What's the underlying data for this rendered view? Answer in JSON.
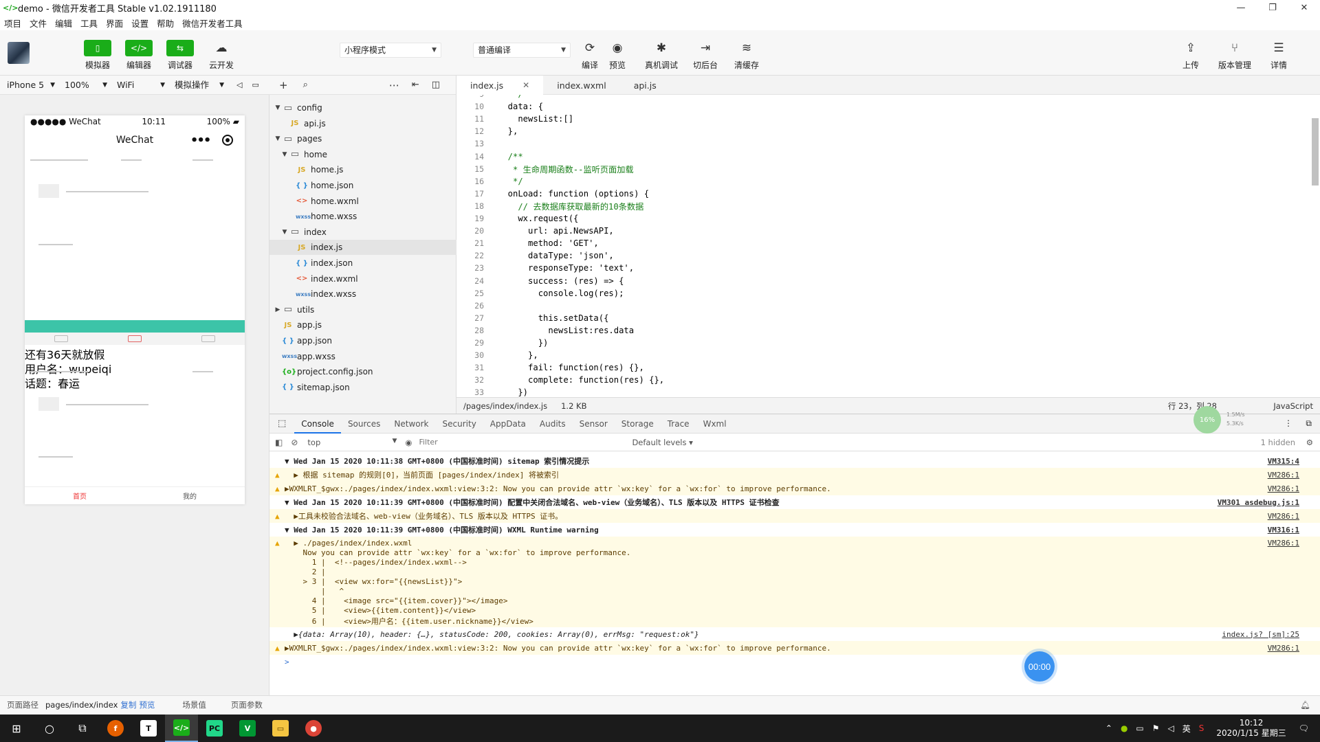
{
  "window": {
    "title": "demo - 微信开发者工具 Stable v1.02.1911180",
    "controls": [
      "—",
      "❐",
      "✕"
    ]
  },
  "menu": [
    "项目",
    "文件",
    "编辑",
    "工具",
    "界面",
    "设置",
    "帮助",
    "微信开发者工具"
  ],
  "toolbar": {
    "simulator": "模拟器",
    "editor": "编辑器",
    "debugger": "调试器",
    "cloud": "云开发",
    "mode": "小程序模式",
    "compile_mode": "普通编译",
    "compile": "编译",
    "preview": "预览",
    "real_debug": "真机调试",
    "background": "切后台",
    "clear_cache": "清缓存",
    "upload": "上传",
    "version": "版本管理",
    "details": "详情"
  },
  "devbar": {
    "device": "iPhone 5",
    "zoom": "100%",
    "network": "WiFi",
    "operation": "模拟操作"
  },
  "phone": {
    "carrier": "●●●●● WeChat",
    "time": "10:11",
    "battery": "100%",
    "nav_title": "WeChat",
    "overlay": [
      "还有36天就放假",
      "用户名：wupeiqi",
      "话题：春运"
    ],
    "tab_home": "首页",
    "tab_mine": "我的"
  },
  "footer": {
    "path_label": "页面路径",
    "path": "pages/index/index",
    "copy": "复制",
    "preview": "预览",
    "scene": "场景值",
    "params": "页面参数"
  },
  "explorer": [
    {
      "label": "config",
      "type": "folder",
      "open": true,
      "indent": 0
    },
    {
      "label": "api.js",
      "type": "js",
      "indent": 1
    },
    {
      "label": "pages",
      "type": "folder",
      "open": true,
      "indent": 0
    },
    {
      "label": "home",
      "type": "folder",
      "open": true,
      "indent": 1
    },
    {
      "label": "home.js",
      "type": "js",
      "indent": 2
    },
    {
      "label": "home.json",
      "type": "json",
      "indent": 2
    },
    {
      "label": "home.wxml",
      "type": "wxml",
      "indent": 2
    },
    {
      "label": "home.wxss",
      "type": "wxss",
      "indent": 2
    },
    {
      "label": "index",
      "type": "folder",
      "open": true,
      "indent": 1
    },
    {
      "label": "index.js",
      "type": "js",
      "indent": 2,
      "selected": true
    },
    {
      "label": "index.json",
      "type": "json",
      "indent": 2
    },
    {
      "label": "index.wxml",
      "type": "wxml",
      "indent": 2
    },
    {
      "label": "index.wxss",
      "type": "wxss",
      "indent": 2
    },
    {
      "label": "utils",
      "type": "folder",
      "open": false,
      "indent": 0
    },
    {
      "label": "app.js",
      "type": "js",
      "indent": 0
    },
    {
      "label": "app.json",
      "type": "json",
      "indent": 0
    },
    {
      "label": "app.wxss",
      "type": "wxss",
      "indent": 0
    },
    {
      "label": "project.config.json",
      "type": "cfg",
      "indent": 0
    },
    {
      "label": "sitemap.json",
      "type": "json",
      "indent": 0
    }
  ],
  "tabs": [
    "index.js",
    "index.wxml",
    "api.js"
  ],
  "code": [
    {
      "n": "9",
      "t": "   */"
    },
    {
      "n": "10",
      "t": "  data: {"
    },
    {
      "n": "11",
      "t": "    newsList:[]"
    },
    {
      "n": "12",
      "t": "  },"
    },
    {
      "n": "13",
      "t": ""
    },
    {
      "n": "14",
      "t": "  /**"
    },
    {
      "n": "15",
      "t": "   * 生命周期函数--监听页面加载"
    },
    {
      "n": "16",
      "t": "   */"
    },
    {
      "n": "17",
      "t": "  onLoad: function (options) {"
    },
    {
      "n": "18",
      "t": "    // 去数据库获取最新的10条数据"
    },
    {
      "n": "19",
      "t": "    wx.request({"
    },
    {
      "n": "20",
      "t": "      url: api.NewsAPI,"
    },
    {
      "n": "21",
      "t": "      method: 'GET',"
    },
    {
      "n": "22",
      "t": "      dataType: 'json',"
    },
    {
      "n": "23",
      "t": "      responseType: 'text',"
    },
    {
      "n": "24",
      "t": "      success: (res) => {"
    },
    {
      "n": "25",
      "t": "        console.log(res);"
    },
    {
      "n": "26",
      "t": ""
    },
    {
      "n": "27",
      "t": "        this.setData({"
    },
    {
      "n": "28",
      "t": "          newsList:res.data"
    },
    {
      "n": "29",
      "t": "        })"
    },
    {
      "n": "30",
      "t": "      },"
    },
    {
      "n": "31",
      "t": "      fail: function(res) {},"
    },
    {
      "n": "32",
      "t": "      complete: function(res) {},"
    },
    {
      "n": "33",
      "t": "    })"
    }
  ],
  "status": {
    "path": "/pages/index/index.js",
    "size": "1.2 KB",
    "position": "行 23，列 28",
    "language": "JavaScript"
  },
  "devtools": {
    "tabs": [
      "Console",
      "Sources",
      "Network",
      "Security",
      "AppData",
      "Audits",
      "Sensor",
      "Storage",
      "Trace",
      "Wxml"
    ],
    "context": "top",
    "filter_placeholder": "Filter",
    "levels": "Default levels ▾",
    "hidden": "1 hidden",
    "perf_pct": "16%",
    "perf_up": "1.5M/s",
    "perf_down": "5.3K/s"
  },
  "console": [
    {
      "kind": "group",
      "text": "▼ Wed Jan 15 2020 10:11:38 GMT+0800 (中国标准时间) sitemap 索引情况提示",
      "src": "VM315:4"
    },
    {
      "kind": "warn",
      "text": "  ▶ 根据 sitemap 的规则[0]，当前页面 [pages/index/index] 将被索引",
      "src": "VM286:1"
    },
    {
      "kind": "warn",
      "text": "▶WXMLRT_$gwx:./pages/index/index.wxml:view:3:2: Now you can provide attr `wx:key` for a `wx:for` to improve performance.",
      "src": "VM286:1"
    },
    {
      "kind": "group",
      "text": "▼ Wed Jan 15 2020 10:11:39 GMT+0800 (中国标准时间) 配置中关闭合法域名、web-view（业务域名）、TLS 版本以及 HTTPS 证书检查",
      "src": "VM301 asdebug.js:1"
    },
    {
      "kind": "warn",
      "text": "  ▶工具未校验合法域名、web-view（业务域名）、TLS 版本以及 HTTPS 证书。",
      "src": "VM286:1"
    },
    {
      "kind": "group",
      "text": "▼ Wed Jan 15 2020 10:11:39 GMT+0800 (中国标准时间) WXML Runtime warning",
      "src": "VM316:1"
    },
    {
      "kind": "warnblock",
      "lines": [
        "  ▶ ./pages/index/index.wxml",
        "    Now you can provide attr `wx:key` for a `wx:for` to improve performance.",
        "      1 |  <!--pages/index/index.wxml-->",
        "      2 |",
        "    > 3 |  <view wx:for=\"{{newsList}}\">",
        "        |   ^",
        "      4 |    <image src=\"{{item.cover}}\"></image>",
        "      5 |    <view>{{item.content}}</view>",
        "      6 |    <view>用户名：{{item.user.nickname}}</view>"
      ],
      "src": "VM286:1"
    },
    {
      "kind": "log",
      "text": "  ▶{data: Array(10), header: {…}, statusCode: 200, cookies: Array(0), errMsg: \"request:ok\"}",
      "src": "index.js? [sm]:25"
    },
    {
      "kind": "warn",
      "text": "▶WXMLRT_$gwx:./pages/index/index.wxml:view:3:2: Now you can provide attr `wx:key` for a `wx:for` to improve performance.",
      "src": "VM286:1"
    },
    {
      "kind": "prompt",
      "text": ">",
      "src": ""
    }
  ],
  "timer": "00:00",
  "taskbar": {
    "time": "10:12",
    "date": "2020/1/15 星期三",
    "ime": "英"
  }
}
